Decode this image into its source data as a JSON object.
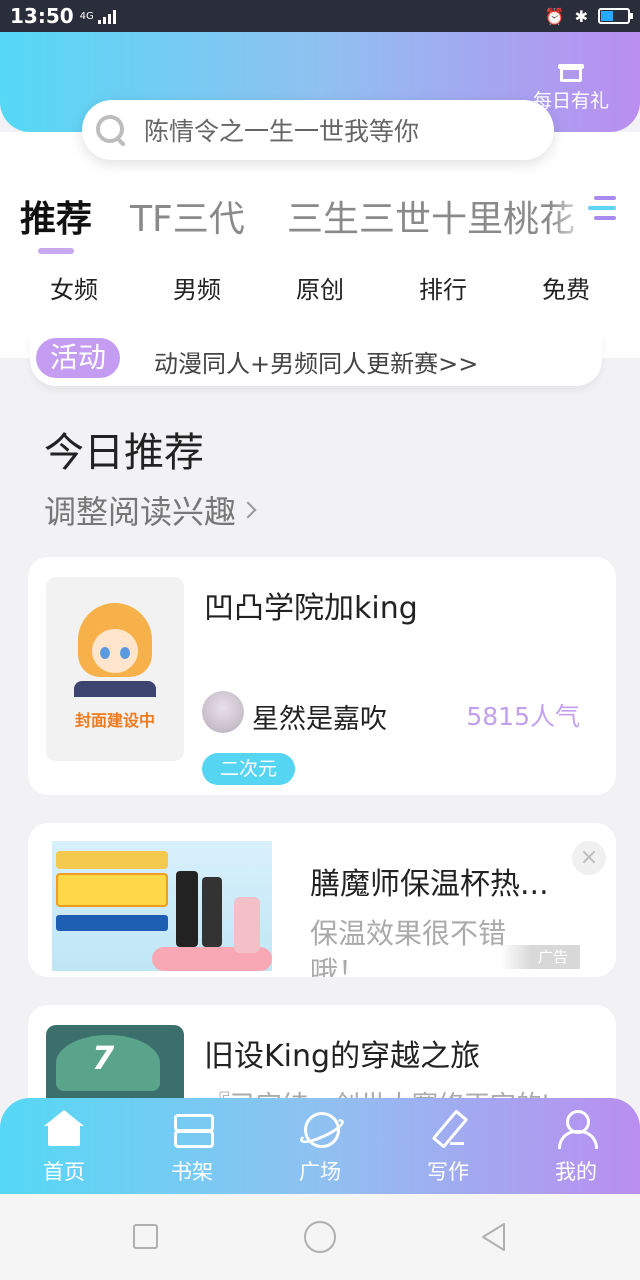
{
  "status_bar": {
    "time": "13:50",
    "network": "4G"
  },
  "header": {
    "gift_label": "每日有礼",
    "search_placeholder": "陈情令之一生一世我等你"
  },
  "tabs": [
    {
      "label": "推荐",
      "active": true
    },
    {
      "label": "TF三代",
      "active": false
    },
    {
      "label": "三生三世十里桃花",
      "active": false
    }
  ],
  "categories": [
    "女频",
    "男频",
    "原创",
    "排行",
    "免费"
  ],
  "activity": {
    "badge": "活动",
    "text": "动漫同人+男频同人更新赛>>"
  },
  "today": {
    "title": "今日推荐",
    "adjust_label": "调整阅读兴趣"
  },
  "books": [
    {
      "title": "凹凸学院加king",
      "cover_caption": "封面建设中",
      "author": "星然是嘉吹",
      "popularity": "5815人气",
      "tag": "二次元"
    },
    {
      "title": "旧设King的穿越之旅",
      "description": "『已完结』创世大赛修正完的b"
    }
  ],
  "ad": {
    "title": "膳魔师保温杯热...",
    "description": "保温效果很不错哦！",
    "label": "广告",
    "close": "×"
  },
  "bottom_nav": [
    {
      "label": "首页",
      "icon": "home-icon"
    },
    {
      "label": "书架",
      "icon": "bookshelf-icon"
    },
    {
      "label": "广场",
      "icon": "planet-icon"
    },
    {
      "label": "写作",
      "icon": "pen-icon"
    },
    {
      "label": "我的",
      "icon": "user-icon"
    }
  ],
  "colors": {
    "gradient_start": "#55d8f5",
    "gradient_end": "#b98ef0",
    "accent_purple": "#c39ff0",
    "tag_cyan": "#55d5f2"
  }
}
